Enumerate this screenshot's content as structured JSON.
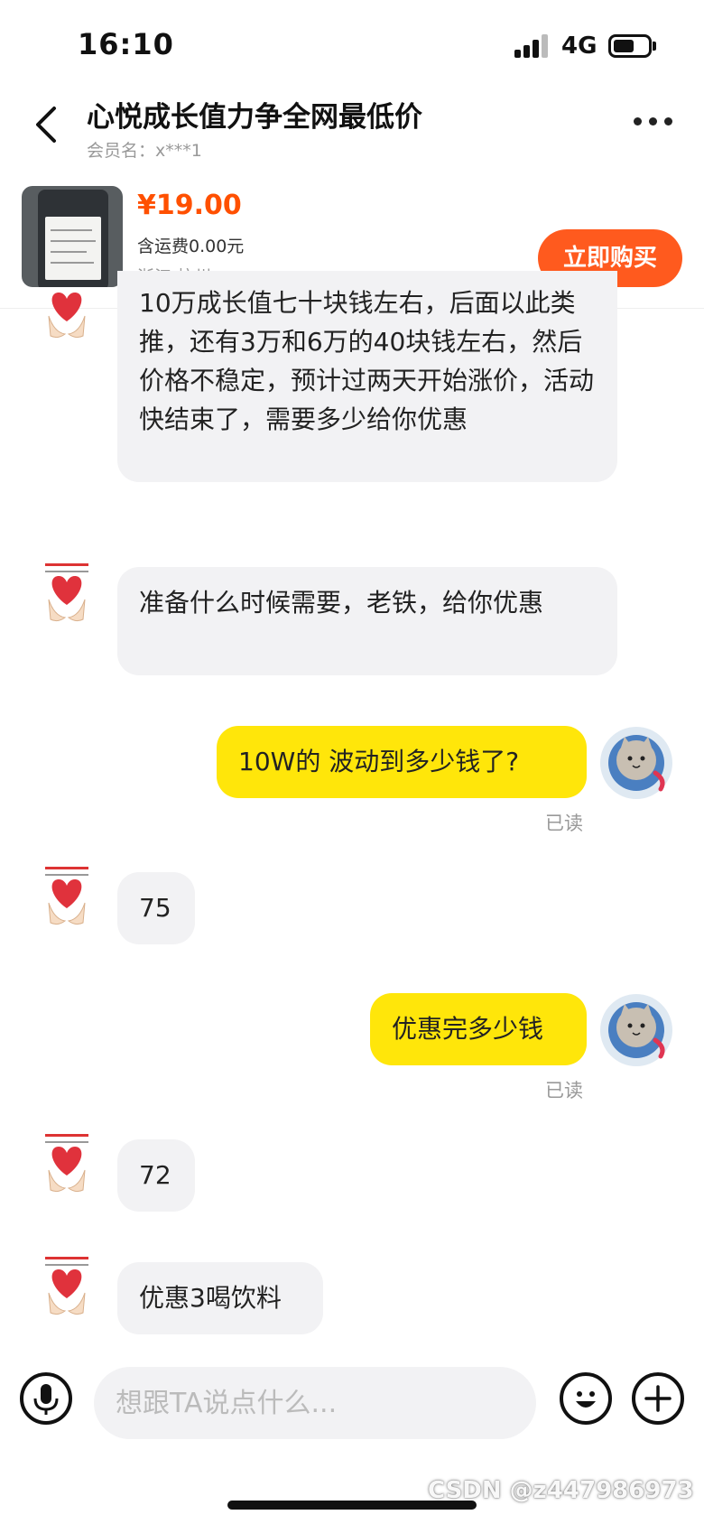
{
  "status_bar": {
    "time": "16:10",
    "network": "4G"
  },
  "header": {
    "title": "心悦成长值力争全网最低价",
    "member": "会员名：x***1"
  },
  "product": {
    "price": "¥19.00",
    "shipping": "含运费0.00元",
    "location": "浙江·杭州",
    "buy_label": "立即购买"
  },
  "messages": [
    {
      "side": "left",
      "text": "10万成长值七十块钱左右，后面以此类推，还有3万和6万的40块钱左右，然后价格不稳定，预计过两天开始涨价，活动快结束了，需要多少给你优惠"
    },
    {
      "side": "left",
      "text": "准备什么时候需要，老铁，给你优惠"
    },
    {
      "side": "right",
      "text": "10W的 波动到多少钱了?",
      "status": "已读"
    },
    {
      "side": "left",
      "text": "75"
    },
    {
      "side": "right",
      "text": "优惠完多少钱",
      "status": "已读"
    },
    {
      "side": "left",
      "text": "72"
    },
    {
      "side": "left",
      "text": "优惠3喝饮料"
    }
  ],
  "input": {
    "placeholder": "想跟TA说点什么..."
  },
  "watermark": "CSDN @z447986973",
  "icons": {
    "back": "chevron-left-icon",
    "more": "more-dots-icon",
    "mic": "mic-icon",
    "emoji": "emoji-icon",
    "plus": "plus-icon"
  },
  "colors": {
    "accent": "#ff5000",
    "buy_button": "#ff5a1e",
    "my_bubble": "#ffe60a",
    "their_bubble": "#f2f2f4"
  }
}
